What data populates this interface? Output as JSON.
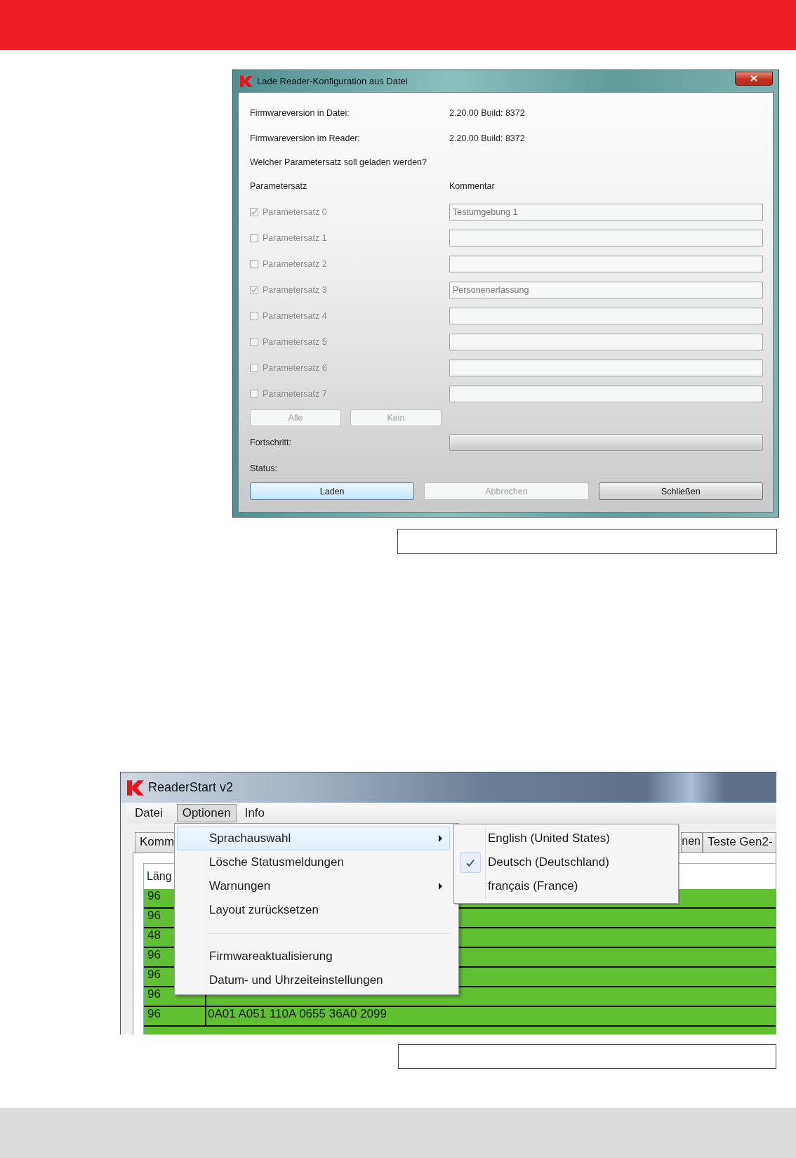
{
  "dialog": {
    "title": "Lade Reader-Konfiguration aus Datei",
    "info": [
      {
        "label": "Firmwareversion in Datei:",
        "value": "2.20.00 Build: 8372"
      },
      {
        "label": "Firmwareversion im Reader:",
        "value": "2.20.00 Build: 8372"
      }
    ],
    "question": "Welcher Parametersatz soll geladen werden?",
    "column_headers": [
      "Parametersatz",
      "Kommentar"
    ],
    "parameter_sets": [
      {
        "label": "Parametersatz 0",
        "checked": true,
        "disabled": true,
        "comment": "Testumgebung 1"
      },
      {
        "label": "Parametersatz 1",
        "checked": false,
        "disabled": true
      },
      {
        "label": "Parametersatz 2",
        "checked": false,
        "disabled": true
      },
      {
        "label": "Parametersatz 3",
        "checked": true,
        "disabled": true,
        "comment": "Personenerfassung"
      },
      {
        "label": "Parametersatz 4",
        "checked": false,
        "disabled": true
      },
      {
        "label": "Parametersatz 5",
        "checked": false,
        "disabled": true
      },
      {
        "label": "Parametersatz 6",
        "checked": false,
        "disabled": true
      },
      {
        "label": "Parametersatz 7",
        "checked": false,
        "disabled": true
      }
    ],
    "select_buttons": [
      {
        "label": "Alle",
        "disabled": true
      },
      {
        "label": "Kein",
        "disabled": true
      }
    ],
    "progress": {
      "label": "Fortschritt:",
      "level": 0
    },
    "status": {
      "label": "Status:"
    },
    "buttons": [
      {
        "label": "Laden",
        "default": true,
        "disabled": false
      },
      {
        "label": "Abbrechen",
        "default": false,
        "disabled": true
      },
      {
        "label": "Schließen",
        "default": false,
        "disabled": false
      }
    ]
  },
  "app_window": {
    "title": "ReaderStart v2",
    "menu_bar": [
      {
        "label": "Datei",
        "selected": false
      },
      {
        "label": "Optionen",
        "selected": true
      },
      {
        "label": "Info",
        "selected": false
      }
    ],
    "tabs": [
      {
        "label": "Komm"
      },
      {
        "label": "nen"
      },
      {
        "label": "Teste Gen2-"
      }
    ],
    "table": {
      "columns": [
        "Läng"
      ],
      "rows": [
        {
          "cells": [
            "96"
          ]
        },
        {
          "cells": [
            "96"
          ]
        },
        {
          "cells": [
            "48"
          ]
        },
        {
          "cells": [
            "96"
          ]
        },
        {
          "cells": [
            "96"
          ]
        },
        {
          "cells": [
            "96"
          ]
        },
        {
          "cells": [
            "96",
            "0A01 A051 110A 0655 36A0 2099"
          ]
        }
      ]
    },
    "menu": {
      "items": [
        {
          "kind": "item",
          "label": "Sprachauswahl",
          "submenu": true,
          "selected": true
        },
        {
          "kind": "item",
          "label": "Lösche Statusmeldungen",
          "submenu": false,
          "selected": false
        },
        {
          "kind": "item",
          "label": "Warnungen",
          "submenu": true,
          "selected": false
        },
        {
          "kind": "item",
          "label": "Layout zurücksetzen",
          "submenu": false,
          "selected": false
        },
        {
          "kind": "separator"
        },
        {
          "kind": "item",
          "label": "Firmwareaktualisierung",
          "submenu": false,
          "selected": false
        },
        {
          "kind": "item",
          "label": "Datum- und Uhrzeiteinstellungen",
          "submenu": false,
          "selected": false
        }
      ]
    },
    "submenu": {
      "items": [
        {
          "label": "English (United States)",
          "checked": false
        },
        {
          "label": "Deutsch (Deutschland)",
          "checked": true
        },
        {
          "label": "français (France)",
          "checked": false
        }
      ]
    }
  }
}
